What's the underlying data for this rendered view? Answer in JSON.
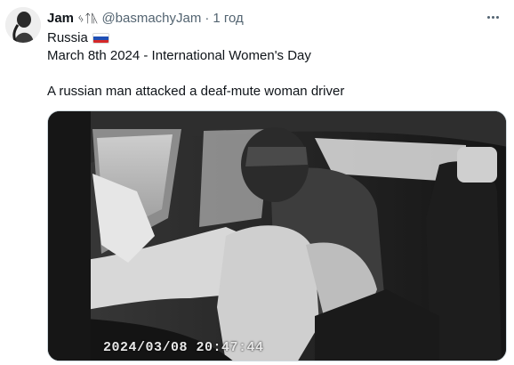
{
  "author": {
    "display_name": "Jam",
    "name_glyph": "ᛃᛏᚣ",
    "handle": "@basmachyJam",
    "separator": "·",
    "time_ago": "1 год"
  },
  "tweet": {
    "line1": "Russia",
    "line2": "March 8th 2024 - International Women's Day",
    "line3": "A russian man attacked a deaf-mute woman driver",
    "flag_colors": [
      "#ffffff",
      "#1f4fb5",
      "#d62828"
    ]
  },
  "media": {
    "overlay_timestamp": "2024/03/08 20:47:44"
  },
  "icons": {
    "more": "more-horizontal-icon",
    "avatar": "avatar"
  }
}
